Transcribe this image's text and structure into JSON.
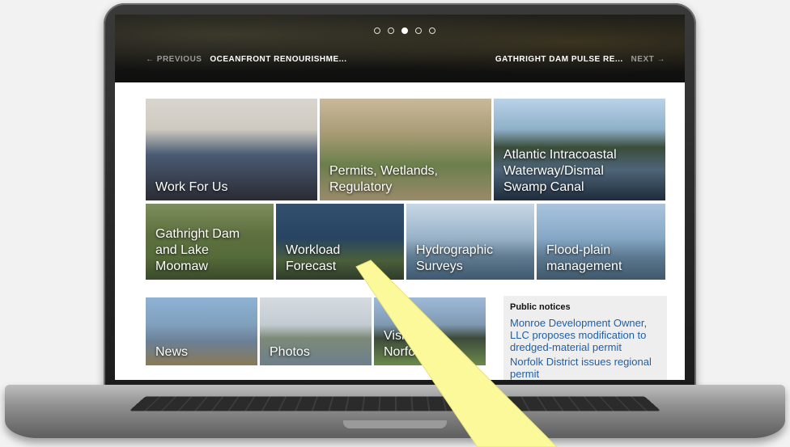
{
  "carousel": {
    "dots": [
      false,
      false,
      true,
      false,
      false
    ],
    "prev_dir": "← PREVIOUS",
    "prev_title": "OCEANFRONT RENOURISHME...",
    "next_title": "GATHRIGHT DAM PULSE RE...",
    "next_dir": "NEXT →"
  },
  "tiles": {
    "work": [
      "Work For Us"
    ],
    "permits": [
      "Permits, Wetlands,",
      "Regulatory"
    ],
    "atlantic": [
      "Atlantic Intracoastal",
      "Waterway/Dismal",
      "Swamp Canal"
    ],
    "gathright": [
      "Gathright Dam",
      "and Lake",
      "Moomaw"
    ],
    "workload": [
      "Workload",
      "Forecast"
    ],
    "hydro": [
      "Hydrographic",
      "Surveys"
    ],
    "flood": [
      "Flood-plain",
      "management"
    ],
    "news": [
      "News"
    ],
    "photos": [
      "Photos"
    ],
    "visit": [
      "Visit Fort",
      "Norfolk"
    ]
  },
  "notices": {
    "title": "Public notices",
    "items": [
      "Monroe Development Owner, LLC proposes modification to dredged-material permit",
      "Norfolk District issues regional permit"
    ]
  },
  "colors": {
    "link": "#1f5fa8",
    "beam": "#fbf99a"
  }
}
